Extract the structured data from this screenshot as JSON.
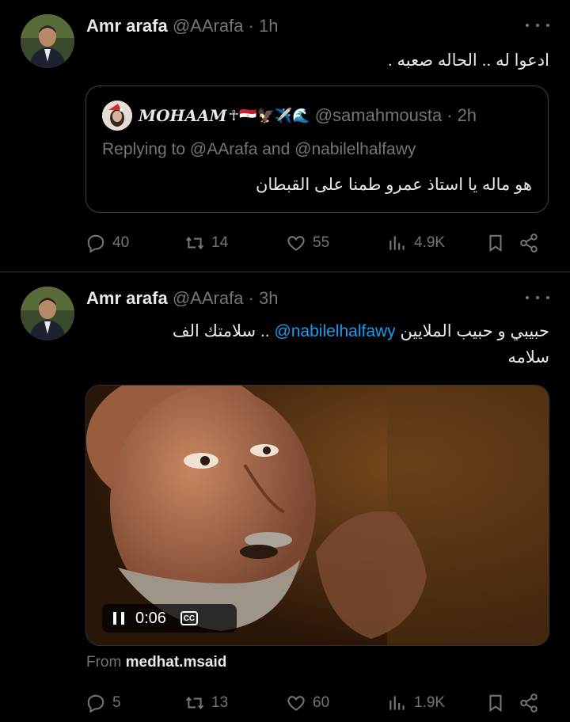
{
  "tweets": [
    {
      "author_name": "Amr arafa",
      "handle": "@AArafa",
      "time": "1h",
      "text": "ادعوا له .. الحاله صعبه .",
      "quote": {
        "name": "𝑴𝑶𝑯𝑨𝑨𝑴",
        "emoji": "☥🇪🇬🦅✈️🌊",
        "handle": "@samahmousta",
        "time": "2h",
        "replying_to": "Replying to @AArafa and @nabilelhalfawy",
        "text": "هو ماله يا استاذ عمرو طمنا على القبطان"
      },
      "stats": {
        "replies": "40",
        "reposts": "14",
        "likes": "55",
        "views": "4.9K"
      }
    },
    {
      "author_name": "Amr arafa",
      "handle": "@AArafa",
      "time": "3h",
      "text_line1_pre": "حبيبي و حبيب الملايين ",
      "mention": "@nabilelhalfawy",
      "text_line1_post": " .. سلامتك الف",
      "text_line2": "سلامه",
      "video": {
        "time": "0:06",
        "cc_label": "CC"
      },
      "from_label": "From",
      "from_user": "medhat.msaid",
      "stats": {
        "replies": "5",
        "reposts": "13",
        "likes": "60",
        "views": "1.9K"
      }
    }
  ],
  "colors": {
    "background": "#000000",
    "text": "#e7e9ea",
    "secondary": "#71767b",
    "link": "#1d9bf0",
    "border": "#2f3336"
  }
}
